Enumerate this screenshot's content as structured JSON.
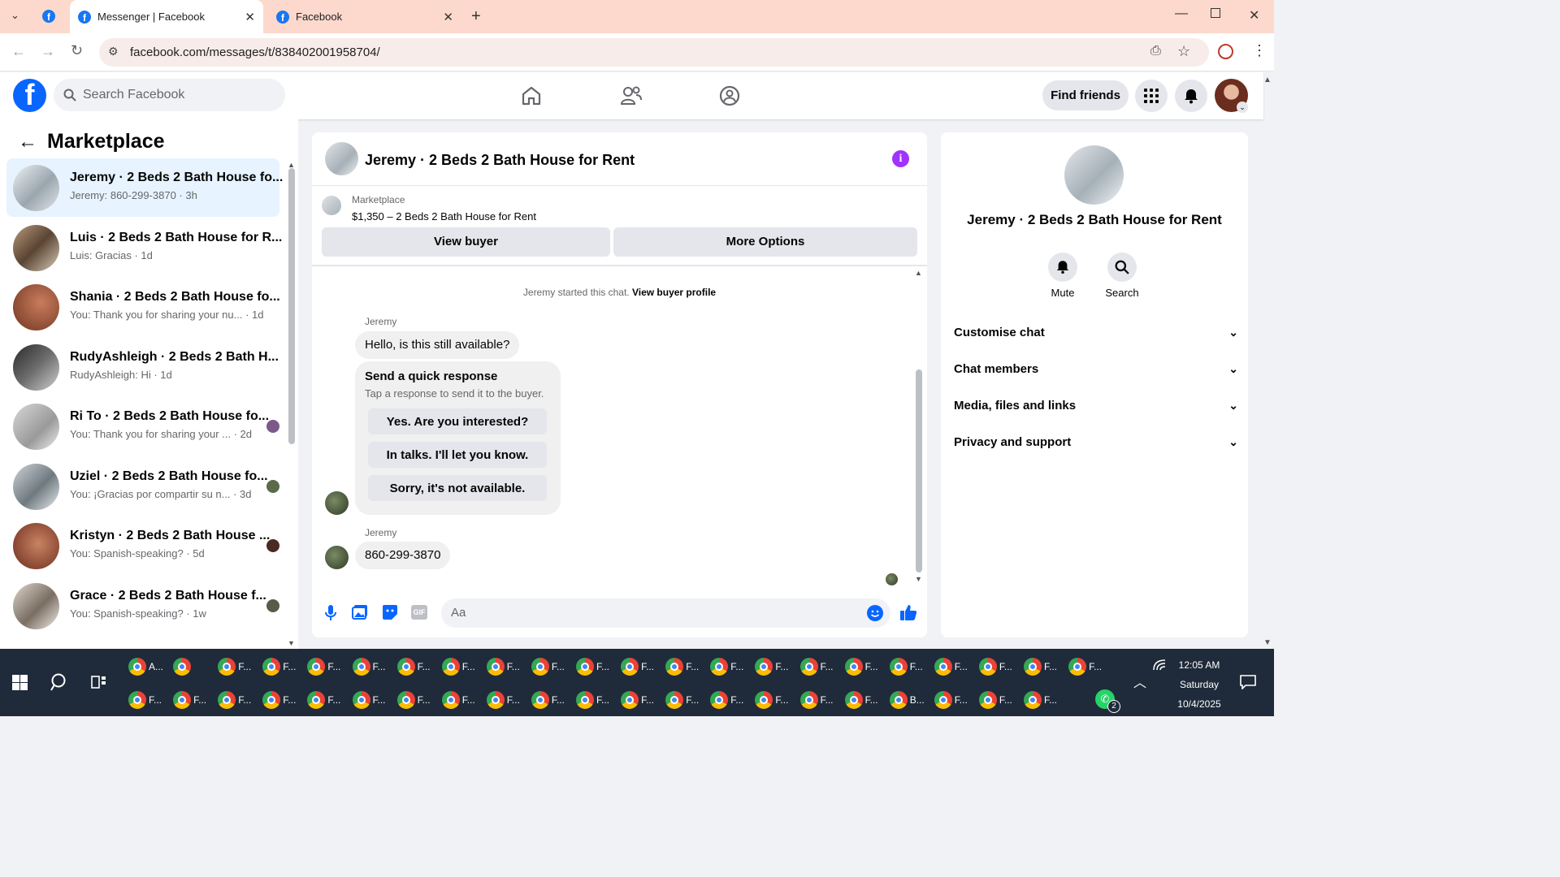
{
  "browser": {
    "tabs": [
      {
        "title": "Messenger | Facebook",
        "active": true
      },
      {
        "title": "Facebook",
        "active": false
      }
    ],
    "url": "facebook.com/messages/t/838402001958704/"
  },
  "fb_header": {
    "search_placeholder": "Search Facebook",
    "find_friends": "Find friends"
  },
  "left": {
    "title": "Marketplace",
    "conversations": [
      {
        "name": "Jeremy · 2 Beds 2 Bath House fo...",
        "preview": "Jeremy: 860-299-3870 · 3h",
        "selected": true
      },
      {
        "name": "Luis · 2 Beds 2 Bath House for R...",
        "preview": "Luis: Gracias · 1d"
      },
      {
        "name": "Shania · 2 Beds 2 Bath House fo...",
        "preview": "You: Thank you for sharing your nu...  · 1d"
      },
      {
        "name": "RudyAshleigh · 2 Beds 2 Bath H...",
        "preview": "RudyAshleigh: Hi · 1d"
      },
      {
        "name": "Ri To · 2 Beds 2 Bath House fo...",
        "preview": "You: Thank you for sharing your ...  · 2d"
      },
      {
        "name": "Uziel · 2 Beds 2 Bath House fo...",
        "preview": "You: ¡Gracias por compartir su n...  · 3d"
      },
      {
        "name": "Kristyn · 2 Beds 2 Bath House ...",
        "preview": "You: Spanish-speaking? · 5d"
      },
      {
        "name": "Grace · 2 Beds 2 Bath House f...",
        "preview": "You: Spanish-speaking? · 1w"
      }
    ]
  },
  "chat": {
    "title": "Jeremy · 2 Beds 2 Bath House for Rent",
    "marketplace_label": "Marketplace",
    "listing": "$1,350 – 2 Beds 2 Bath House for Rent",
    "view_buyer": "View buyer",
    "more_options": "More Options",
    "system_text": "Jeremy started this chat.",
    "system_link": "View buyer profile",
    "sender_name": "Jeremy",
    "msg1": "Hello, is this still available?",
    "quick_title": "Send a quick response",
    "quick_sub": "Tap a response to send it to the buyer.",
    "quick_options": [
      "Yes. Are you interested?",
      "In talks. I'll let you know.",
      "Sorry, it's not available."
    ],
    "sender_name2": "Jeremy",
    "msg2": "860-299-3870",
    "composer_placeholder": "Aa"
  },
  "info": {
    "title": "Jeremy · 2 Beds 2 Bath House for Rent",
    "mute": "Mute",
    "search": "Search",
    "sections": [
      "Customise chat",
      "Chat members",
      "Media, files and links",
      "Privacy and support"
    ]
  },
  "taskbar": {
    "time": "12:05 AM",
    "day": "Saturday",
    "date": "10/4/2025",
    "row1": [
      "A...",
      "",
      "F...",
      "F...",
      "F...",
      "F...",
      "F...",
      "F...",
      "F...",
      "F...",
      "F...",
      "F...",
      "F...",
      "F...",
      "F...",
      "F...",
      "F...",
      "F...",
      "F...",
      "F...",
      "F...",
      "F..."
    ],
    "row2": [
      "F...",
      "F...",
      "F...",
      "F...",
      "F...",
      "F...",
      "F...",
      "F...",
      "F...",
      "F...",
      "F...",
      "F...",
      "F...",
      "F...",
      "F...",
      "F...",
      "F...",
      "B...",
      "F...",
      "F...",
      "F..."
    ],
    "whatsapp_badge": "2"
  },
  "colors": {
    "fb_blue": "#0866ff",
    "selected_bg": "#e7f3ff",
    "tabbar": "#fcd9cc",
    "taskbar": "#1f2b3a",
    "accent_purple": "#a033ff"
  }
}
